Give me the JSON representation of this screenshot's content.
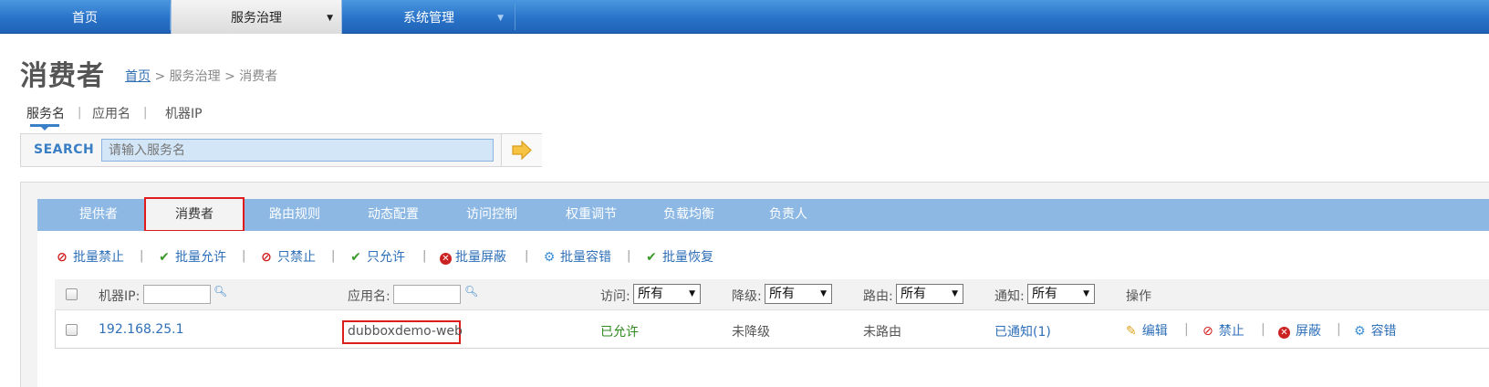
{
  "nav": {
    "items": [
      {
        "label": "首页"
      },
      {
        "label": "服务治理"
      },
      {
        "label": "系统管理"
      }
    ],
    "caret": "▼"
  },
  "page": {
    "title": "消费者",
    "breadcrumb": {
      "home": "首页",
      "rest": " > 服务治理 > 消费者"
    }
  },
  "search": {
    "tabs": [
      "服务名",
      "应用名",
      "机器IP"
    ],
    "label": "SEARCH",
    "placeholder": "请输入服务名"
  },
  "tabs": [
    "提供者",
    "消费者",
    "路由规则",
    "动态配置",
    "访问控制",
    "权重调节",
    "负载均衡",
    "负责人"
  ],
  "actions": [
    {
      "label": "批量禁止",
      "icon": "ban-icon"
    },
    {
      "label": "批量允许",
      "icon": "check-icon"
    },
    {
      "label": "只禁止",
      "icon": "ban-icon"
    },
    {
      "label": "只允许",
      "icon": "check-icon"
    },
    {
      "label": "批量屏蔽",
      "icon": "x-circle-icon"
    },
    {
      "label": "批量容错",
      "icon": "gear-icon"
    },
    {
      "label": "批量恢复",
      "icon": "check-icon"
    }
  ],
  "table": {
    "headers": {
      "ip": "机器IP:",
      "app": "应用名:",
      "access": "访问:",
      "degrade": "降级:",
      "route": "路由:",
      "notify": "通知:",
      "ops": "操作"
    },
    "filter_value": "所有",
    "rows": [
      {
        "ip": "192.168.25.1",
        "app": "dubboxdemo-web",
        "access": "已允许",
        "degrade": "未降级",
        "route": "未路由",
        "notify": "已通知(1)",
        "ops": {
          "edit": "编辑",
          "forbid": "禁止",
          "shield": "屏蔽",
          "tolerate": "容错"
        }
      }
    ]
  },
  "colors": {
    "nav": "#2a73c9",
    "tabbar": "#8db8e4",
    "highlight": "#e01b1b",
    "link": "#2e6fb8",
    "ok": "#2f8a1f"
  }
}
